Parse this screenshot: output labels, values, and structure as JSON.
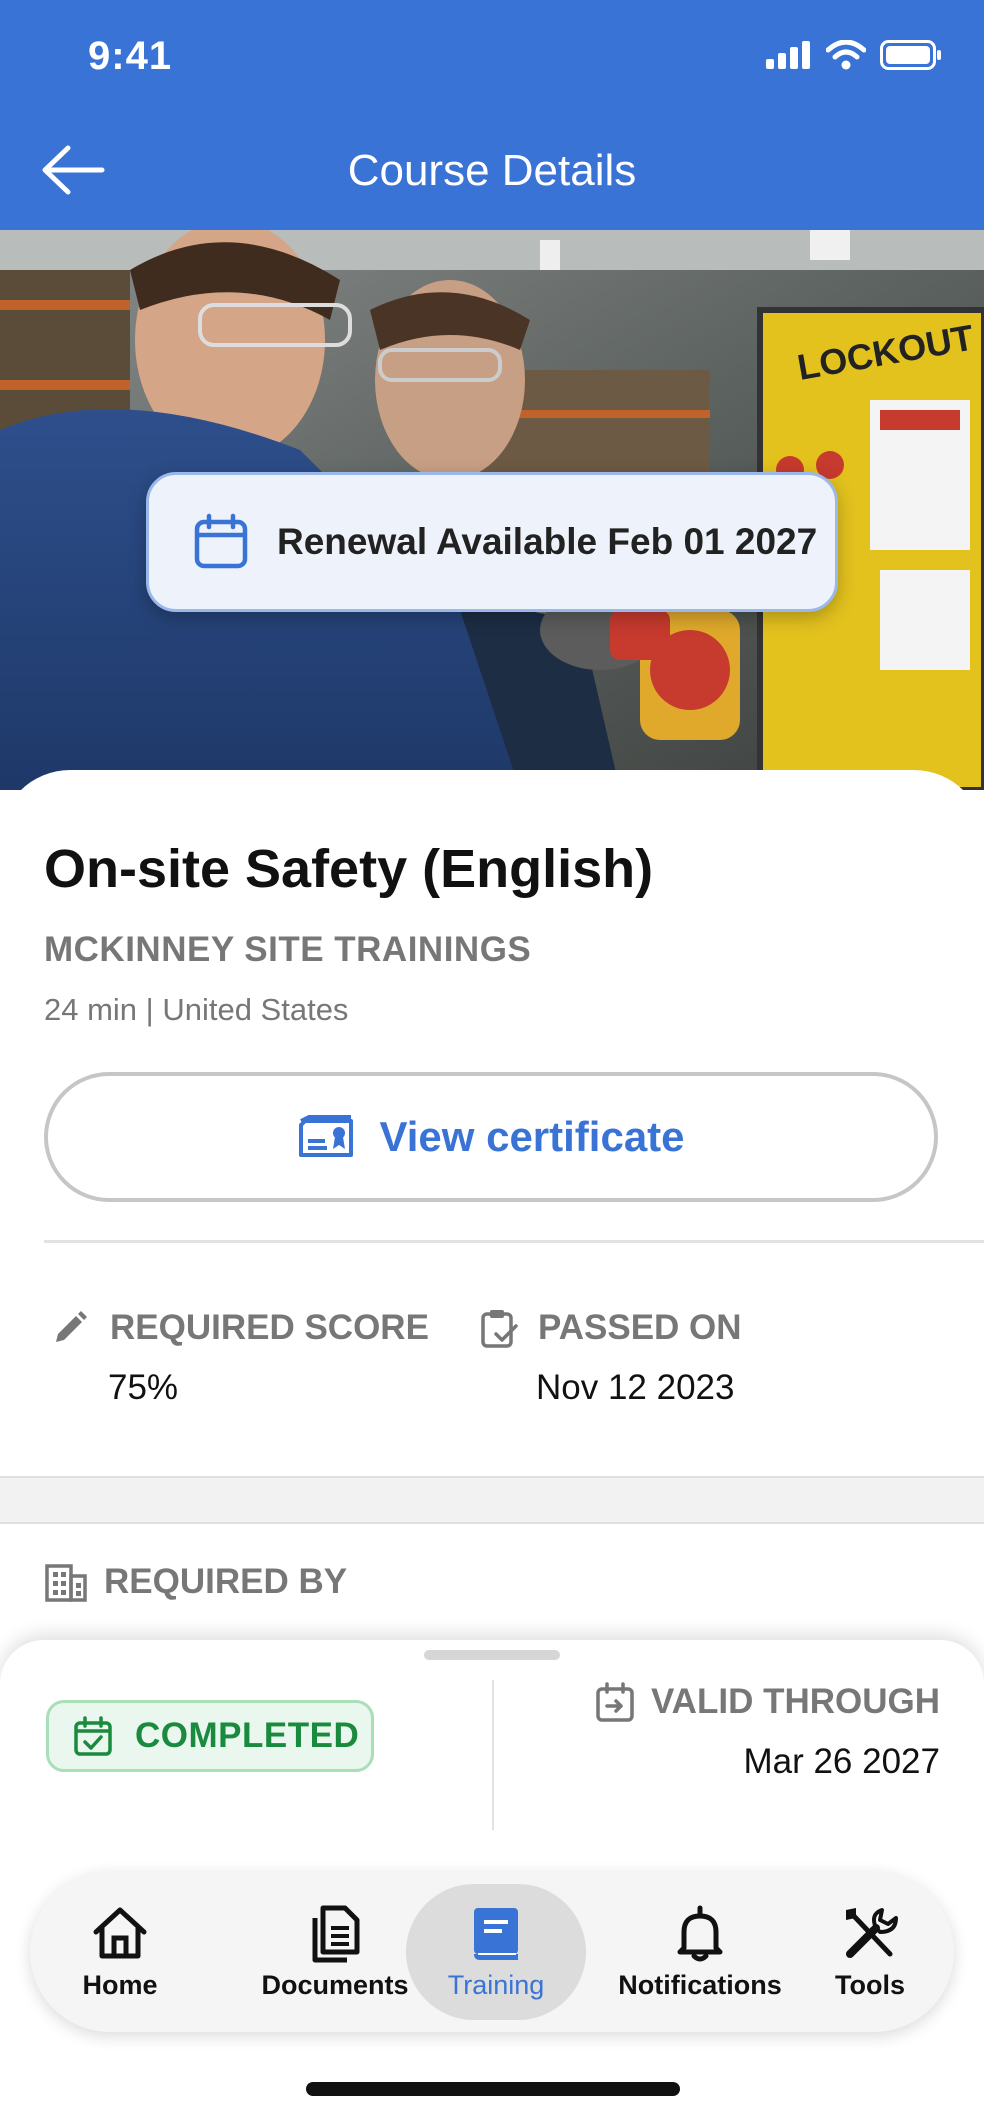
{
  "status_bar": {
    "time": "9:41"
  },
  "header": {
    "title": "Course Details"
  },
  "hero": {
    "image_alt": "",
    "renewal_text": "Renewal Available Feb 01 2027"
  },
  "course": {
    "title": "On-site Safety (English)",
    "organization": "MCKINNEY SITE TRAININGS",
    "meta": "24 min | United States",
    "certificate_button": "View certificate"
  },
  "stats": {
    "required_score_label": "REQUIRED SCORE",
    "required_score_value": "75%",
    "passed_on_label": "PASSED ON",
    "passed_on_value": "Nov 12 2023"
  },
  "required_by": {
    "label": "REQUIRED BY"
  },
  "summary": {
    "status": "COMPLETED",
    "valid_through_label": "VALID THROUGH",
    "valid_through_value": "Mar 26 2027"
  },
  "tabs": [
    {
      "label": "Home",
      "icon": "home-icon"
    },
    {
      "label": "Documents",
      "icon": "documents-icon"
    },
    {
      "label": "Training",
      "icon": "book-icon",
      "active": true
    },
    {
      "label": "Notifications",
      "icon": "bell-icon"
    },
    {
      "label": "Tools",
      "icon": "tools-icon"
    }
  ],
  "colors": {
    "brand": "#3a73d6",
    "success": "#1a8a3e",
    "muted": "#777777"
  }
}
